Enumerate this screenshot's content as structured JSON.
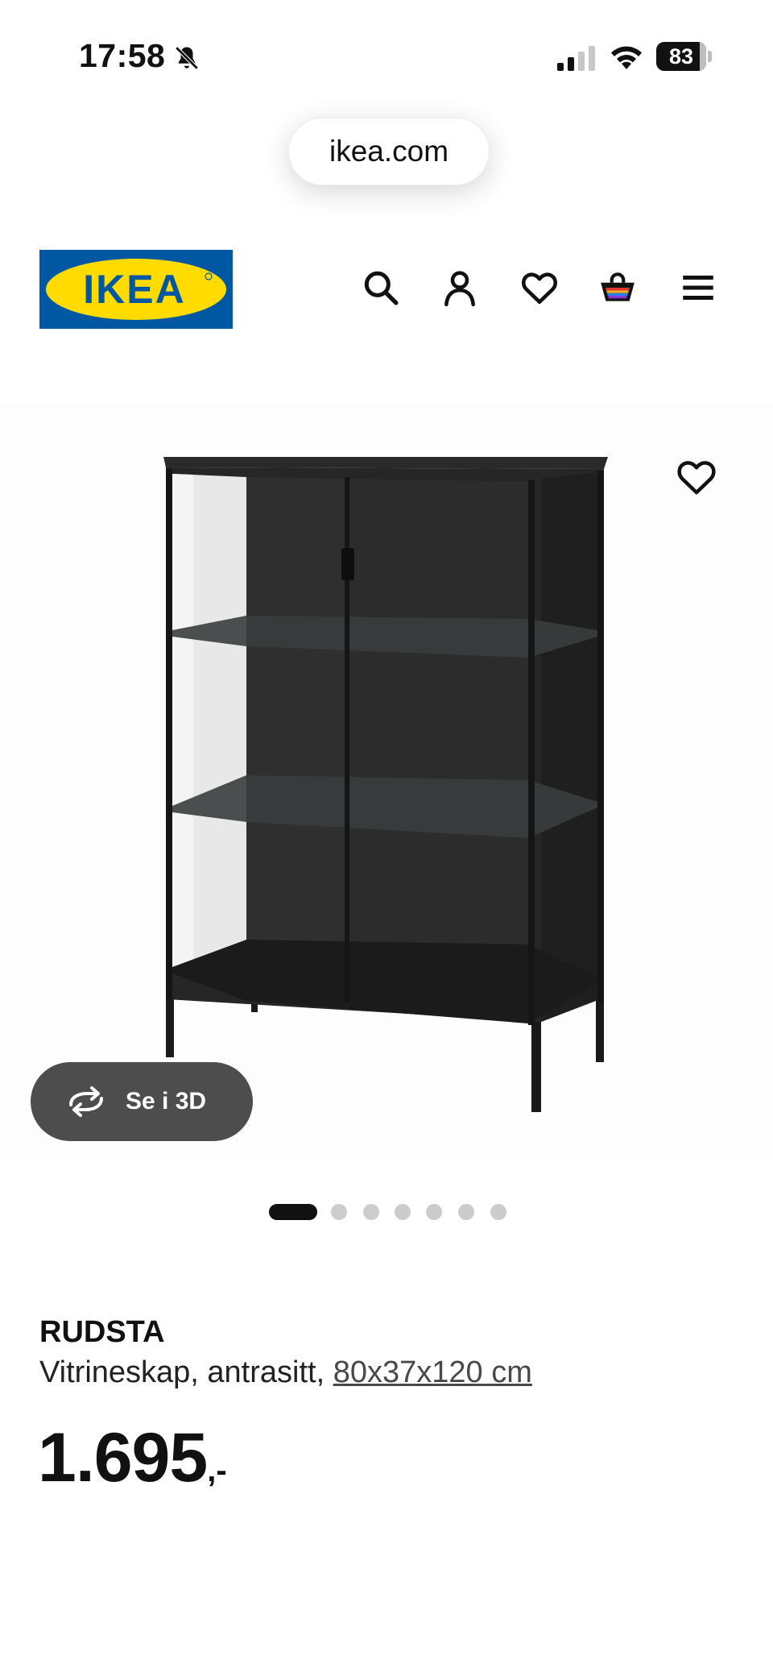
{
  "status_bar": {
    "time": "17:58",
    "battery": "83",
    "icons": [
      "bell-off-icon",
      "signal-icon",
      "wifi-icon",
      "battery-icon"
    ]
  },
  "browser": {
    "url": "ikea.com"
  },
  "header": {
    "logo_text": "IKEA",
    "icons": [
      "search-icon",
      "account-icon",
      "heart-icon",
      "shopping-bag-icon",
      "menu-icon"
    ]
  },
  "gallery": {
    "see_3d_label": "Se i 3D",
    "dot_count": 7,
    "active_dot": 0
  },
  "product": {
    "name": "RUDSTA",
    "description": "Vitrineskap, antrasitt, ",
    "size": "80x37x120 cm",
    "price_integer": "1.695",
    "price_suffix": ",-"
  },
  "colors": {
    "ikea_blue": "#0058a3",
    "ikea_yellow": "#ffdb00",
    "see_3d_bg": "#4d4d4d",
    "text": "#111111"
  }
}
